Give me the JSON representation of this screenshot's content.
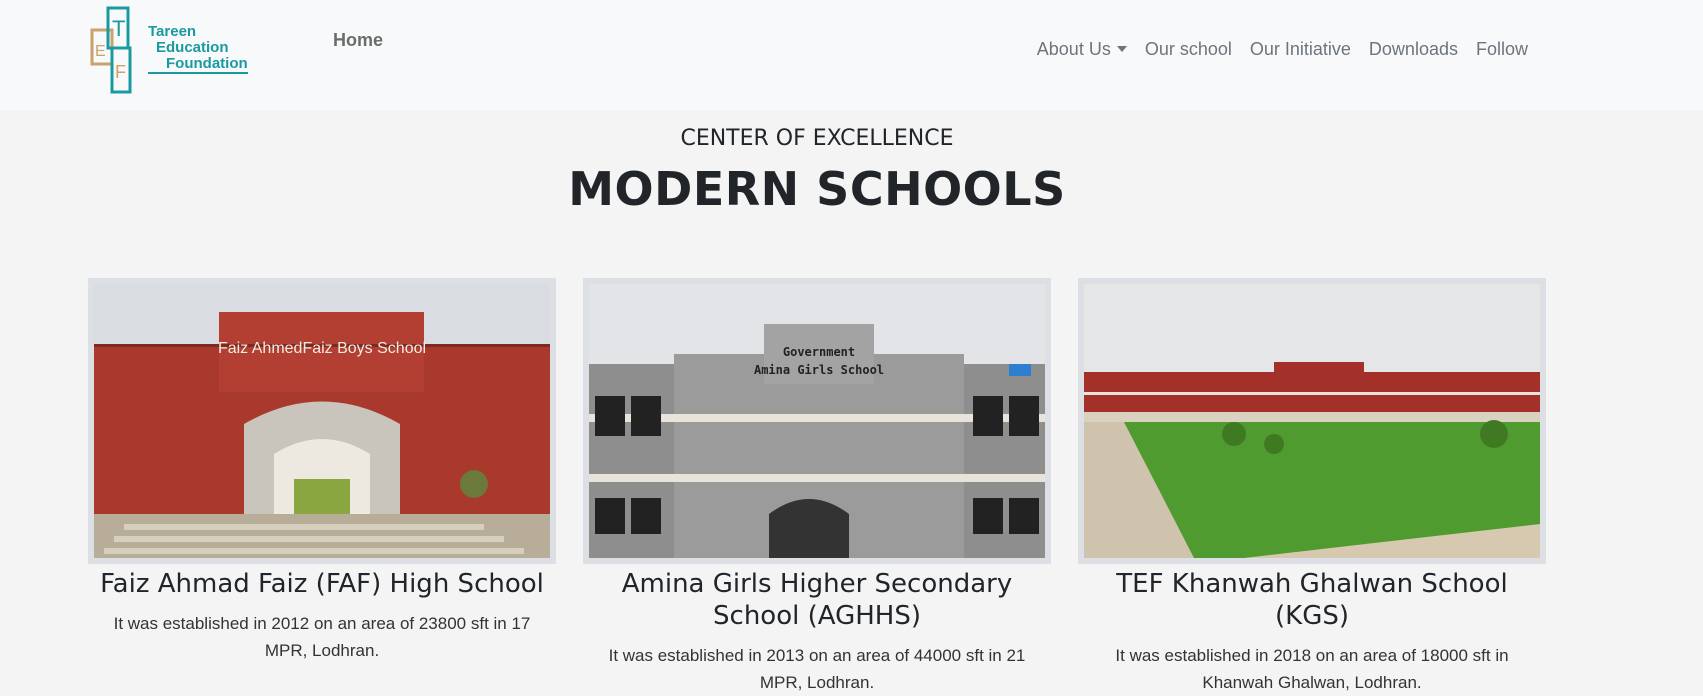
{
  "brand": {
    "logo_lines": [
      "Tareen",
      "Education",
      "Foundation"
    ],
    "logo_letters": [
      "T",
      "E",
      "F"
    ],
    "home_label": "Home"
  },
  "nav": [
    {
      "label": "About Us",
      "dropdown": true
    },
    {
      "label": "Our school"
    },
    {
      "label": "Our Initiative"
    },
    {
      "label": "Downloads"
    },
    {
      "label": "Follow"
    }
  ],
  "hero": {
    "eyebrow": "CENTER OF EXCELLENCE",
    "title": "MODERN SCHOOLS"
  },
  "schools": [
    {
      "name": "Faiz Ahmad Faiz (FAF) High School",
      "description": "It was established in 2012 on an area of 23800 sft in 17 MPR, Lodhran.",
      "sign": "Faiz AhmedFaiz Boys School"
    },
    {
      "name": "Amina Girls Higher Secondary School (AGHHS)",
      "description": "It was established in 2013 on an area of 44000 sft in 21 MPR, Lodhran.",
      "sign_line1": "Government",
      "sign_line2": "Amina Girls School"
    },
    {
      "name": "TEF Khanwah Ghalwan School (KGS)",
      "description": "It was established in 2018 on an area of 18000 sft in Khanwah Ghalwan, Lodhran."
    }
  ],
  "colors": {
    "accent": "#1a9aa0",
    "logo_gold": "#c9a46a",
    "brick": "#a8392c"
  }
}
